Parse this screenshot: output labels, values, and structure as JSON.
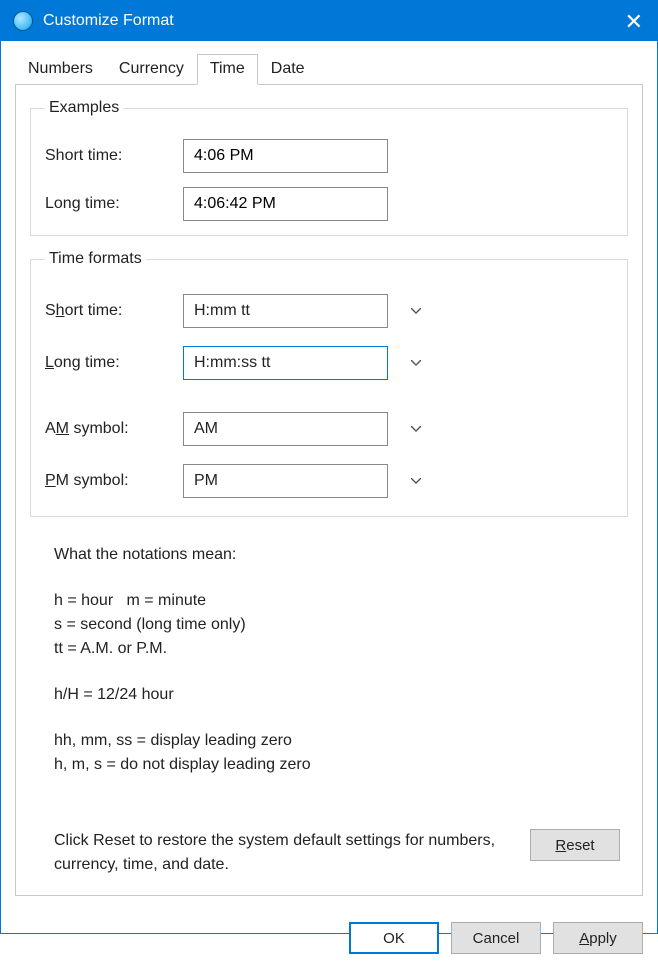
{
  "window": {
    "title": "Customize Format",
    "close_icon": "✕"
  },
  "tabs": {
    "numbers": "Numbers",
    "currency": "Currency",
    "time": "Time",
    "date": "Date"
  },
  "examples": {
    "legend": "Examples",
    "short_label": "Short time:",
    "short_value": "4:06 PM",
    "long_label": "Long time:",
    "long_value": "4:06:42 PM"
  },
  "formats": {
    "legend": "Time formats",
    "short_label_pre": "S",
    "short_label_hot": "h",
    "short_label_post": "ort time:",
    "short_value": "H:mm tt",
    "long_label_pre": "",
    "long_label_hot": "L",
    "long_label_post": "ong time:",
    "long_value": "H:mm:ss tt",
    "am_label_pre": "A",
    "am_label_hot": "M",
    "am_label_post": " symbol:",
    "am_value": "AM",
    "pm_label_pre": "",
    "pm_label_hot": "P",
    "pm_label_post": "M symbol:",
    "pm_value": "PM"
  },
  "notation": {
    "title": "What the notations mean:",
    "l1": "h = hour   m = minute",
    "l2": "s = second (long time only)",
    "l3": "tt = A.M. or P.M.",
    "l4": "h/H = 12/24 hour",
    "l5": "hh, mm, ss = display leading zero",
    "l6": "h, m, s = do not display leading zero"
  },
  "reset": {
    "text": "Click Reset to restore the system default settings for numbers, currency, time, and date.",
    "btn_pre": "",
    "btn_hot": "R",
    "btn_post": "eset"
  },
  "buttons": {
    "ok": "OK",
    "cancel": "Cancel",
    "apply_pre": "",
    "apply_hot": "A",
    "apply_post": "pply"
  }
}
